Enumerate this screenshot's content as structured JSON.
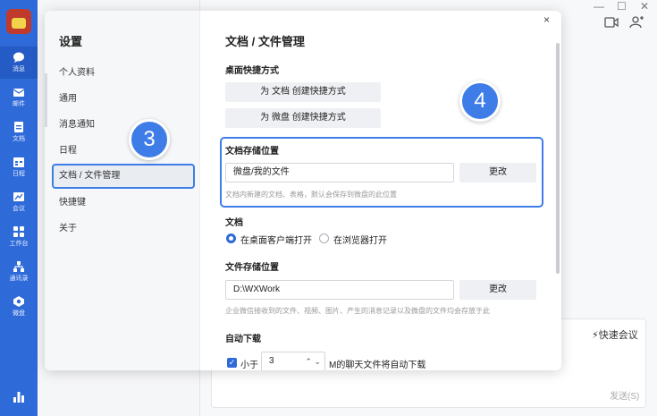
{
  "rail": {
    "items": [
      {
        "label": "消息",
        "icon": "chat-bubble-icon"
      },
      {
        "label": "邮件",
        "icon": "mail-icon"
      },
      {
        "label": "文档",
        "icon": "document-icon"
      },
      {
        "label": "日程",
        "icon": "calendar-icon"
      },
      {
        "label": "会议",
        "icon": "meeting-icon"
      },
      {
        "label": "工作台",
        "icon": "grid-icon"
      },
      {
        "label": "通讯录",
        "icon": "contacts-icon"
      },
      {
        "label": "微盘",
        "icon": "drive-icon"
      }
    ]
  },
  "window": {
    "minimize": "—",
    "maximize": "☐",
    "close": "✕"
  },
  "background": {
    "quick_meeting": "快速会议",
    "send": "发送(S)"
  },
  "dialog": {
    "title": "设置",
    "close": "×",
    "nav": [
      {
        "label": "个人资料"
      },
      {
        "label": "通用"
      },
      {
        "label": "消息通知"
      },
      {
        "label": "日程"
      },
      {
        "label": "文档 / 文件管理"
      },
      {
        "label": "快捷键"
      },
      {
        "label": "关于"
      }
    ],
    "content": {
      "title": "文档 / 文件管理",
      "shortcut_section": "桌面快捷方式",
      "btn_doc_shortcut": "为 文档 创建快捷方式",
      "btn_drive_shortcut": "为 微盘 创建快捷方式",
      "doc_storage_label": "文档存储位置",
      "doc_storage_value": "微盘/我的文件",
      "change": "更改",
      "doc_storage_hint": "文档内新建的文档、表格，默认会保存到微盘的此位置",
      "doc_section": "文档",
      "open_desktop": "在桌面客户端打开",
      "open_browser": "在浏览器打开",
      "file_storage_label": "文件存储位置",
      "file_storage_value": "D:\\WXWork",
      "file_storage_hint": "企业微信接收到的文件、视频、图片、产生的消息记录以及微盘的文件均会存放于此",
      "auto_download": "自动下载",
      "less_than": "小于",
      "size_value": "3",
      "size_suffix": "M的聊天文件将自动下载"
    }
  },
  "badges": {
    "step3": "3",
    "step4": "4"
  },
  "colors": {
    "accent": "#3e7de8",
    "rail": "#2f6ad9"
  }
}
